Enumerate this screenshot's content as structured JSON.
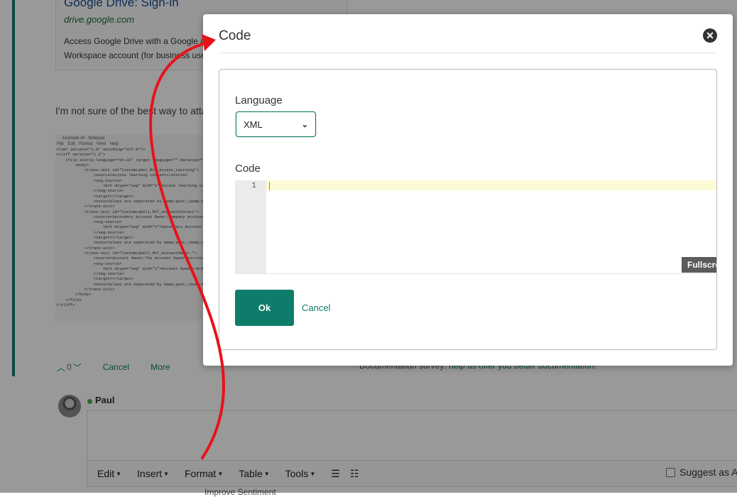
{
  "background": {
    "result": {
      "title": "Google Drive: Sign-in",
      "url": "drive.google.com",
      "snippet": "Access Google Drive with a Google account (for personal use) or Google Workspace account (for business use)."
    },
    "post_text": "I'm not sure of the best way to attach this file, so here is a screenshot:",
    "notepad": {
      "title": "Example.xlf - Notepad",
      "menu": "File Edit Format View Help",
      "body": "<?xml version=\"1.0\" encoding=\"UTF-8\"?>\n<xliff version=\"1.2\">\n    <file source-language=\"en-US\" target-language=\"\" datatype=\"xml\">\n        <body>\n            <trans-unit id=\"CustomLabel.MVT_Access_Learning\">\n                <source>Access learning content</source>\n                <seg-source>\n                    <mrk mtype=\"seg\" mid=\"1\">Access learning content</mrk>\n                </seg-source>\n                <target></target>\n                <note>Values are seperated by &amp;quot;;&amp;quot;</note>\n            </trans-unit>\n            <trans-unit id=\"CustomLabel1.MVT_AccountContact\">\n                <source>Secondary Account Owner;Company Account</source>\n                <seg-source>\n                    <mrk mtype=\"seg\" mid=\"1\">Secondary Account Owner</mrk>\n                </seg-source>\n                <target></target>\n                <note>Values are seperated by &amp;quot;;&amp;quot;</note>\n            </trans-unit>\n            <trans-unit id=\"CustomLabel1.MVT_AccountOwner_\">\n                <source>Account Owner;The Account Owner is</source>\n                <seg-source>\n                    <mrk mtype=\"seg\" mid=\"1\">Account Owner</mrk>\n                </seg-source>\n                <target></target>\n                <note>Values are seperated by &amp;quot;;&amp;quot;</note>\n            </trans-unit>\n        </body>\n    </file>\n</xliff>"
    },
    "votes": {
      "count": "0",
      "cancel": "Cancel",
      "more": "More"
    },
    "doc_survey": {
      "prefix": "Documentation survey:",
      "link": "help us offer you better documentation!"
    },
    "user_name": "Paul",
    "toolbar": {
      "edit": "Edit",
      "insert": "Insert",
      "format": "Format",
      "table": "Table",
      "tools": "Tools"
    },
    "suggest_label": "Suggest as Answer",
    "below_text": "Improve Sentiment"
  },
  "dialog": {
    "title": "Code",
    "language_label": "Language",
    "language_value": "XML",
    "code_label": "Code",
    "line_number": "1",
    "fullscreen_label": "Fullscreen",
    "ok_label": "Ok",
    "cancel_label": "Cancel"
  },
  "colors": {
    "accent": "#0e7c6b",
    "annotation_arrow": "#e8121a"
  }
}
